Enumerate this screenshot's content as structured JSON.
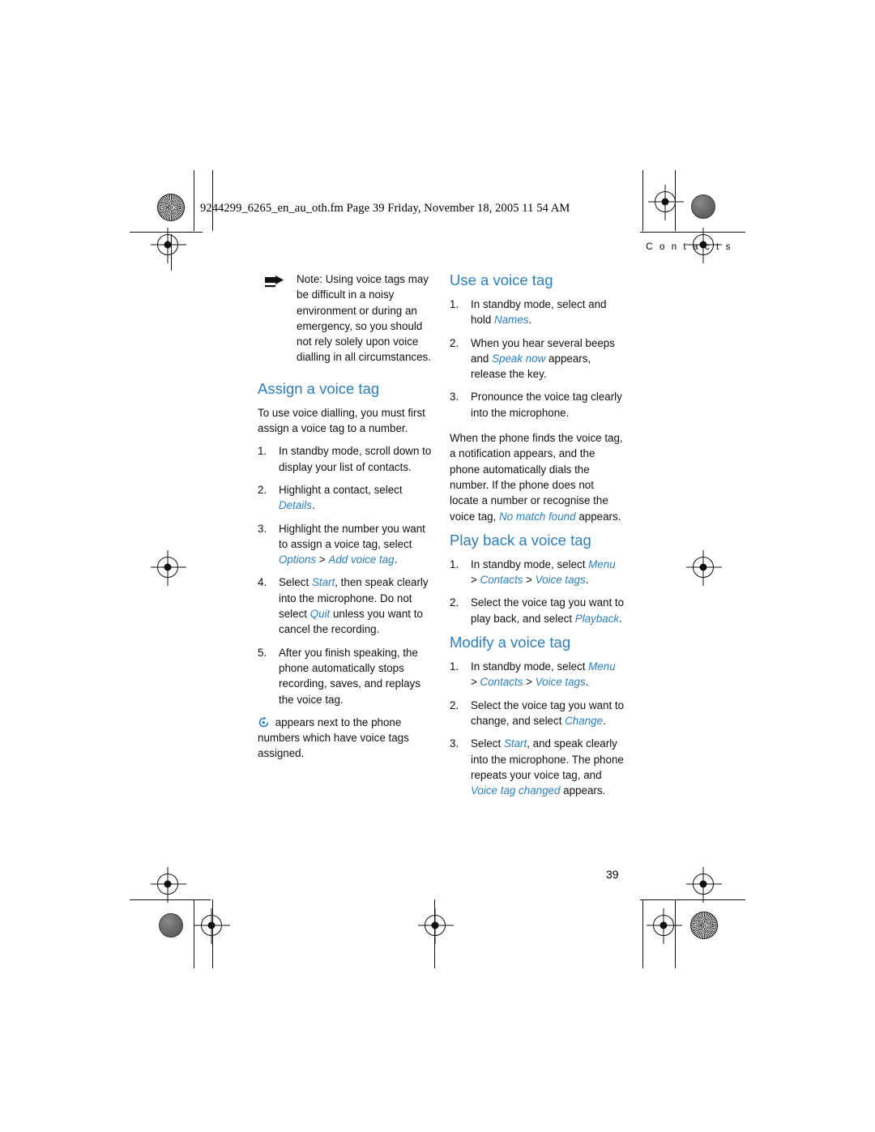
{
  "page": {
    "file_header": "9244299_6265_en_au_oth.fm  Page 39  Friday, November 18, 2005  11 54 AM",
    "running_head": "C o n t a c t s",
    "folio": "39",
    "accent_color": "#2a7fc2"
  },
  "left_column": {
    "note": {
      "label": "Note:",
      "text": " Using voice tags may be difficult in a noisy environment or during an emergency, so you should not rely solely upon voice dialling in all circumstances."
    },
    "assign": {
      "heading": "Assign a voice tag",
      "intro": "To use voice dialling, you must first assign a voice tag to a number.",
      "steps": [
        {
          "parts": [
            {
              "t": "In standby mode, scroll down to display your list of contacts.",
              "s": "plain"
            }
          ]
        },
        {
          "parts": [
            {
              "t": "Highlight a contact, select ",
              "s": "plain"
            },
            {
              "t": "Details",
              "s": "ui"
            },
            {
              "t": ".",
              "s": "plain"
            }
          ]
        },
        {
          "parts": [
            {
              "t": "Highlight the number you want to assign a voice tag, select ",
              "s": "plain"
            },
            {
              "t": "Options",
              "s": "ui"
            },
            {
              "t": " > ",
              "s": "plain"
            },
            {
              "t": "Add voice tag",
              "s": "ui"
            },
            {
              "t": ".",
              "s": "plain"
            }
          ]
        },
        {
          "parts": [
            {
              "t": "Select ",
              "s": "plain"
            },
            {
              "t": "Start",
              "s": "ui"
            },
            {
              "t": ", then speak clearly into the microphone. Do not select ",
              "s": "plain"
            },
            {
              "t": "Quit",
              "s": "ui"
            },
            {
              "t": " unless you want to cancel the recording.",
              "s": "plain"
            }
          ]
        },
        {
          "parts": [
            {
              "t": "After you finish speaking, the phone automatically stops recording, saves, and replays the voice tag.",
              "s": "plain"
            }
          ]
        }
      ],
      "closing": " appears next to the phone numbers which have voice tags assigned."
    }
  },
  "right_column": {
    "use": {
      "heading": "Use a voice tag",
      "steps": [
        {
          "parts": [
            {
              "t": "In standby mode, select and hold ",
              "s": "plain"
            },
            {
              "t": "Names",
              "s": "ui"
            },
            {
              "t": ".",
              "s": "plain"
            }
          ]
        },
        {
          "parts": [
            {
              "t": "When you hear several beeps and ",
              "s": "plain"
            },
            {
              "t": "Speak now",
              "s": "ui"
            },
            {
              "t": " appears, release the key.",
              "s": "plain"
            }
          ]
        },
        {
          "parts": [
            {
              "t": "Pronounce the voice tag clearly into the microphone.",
              "s": "plain"
            }
          ]
        }
      ],
      "continuation": [
        {
          "t": "When the phone finds the voice tag, a notification appears, and the phone automatically dials the number. If the phone does not locate a number or recognise the voice tag, ",
          "s": "plain"
        },
        {
          "t": "No match found",
          "s": "ui"
        },
        {
          "t": " appears.",
          "s": "plain"
        }
      ]
    },
    "playback": {
      "heading": "Play back a voice tag",
      "steps": [
        {
          "parts": [
            {
              "t": "In standby mode, select ",
              "s": "plain"
            },
            {
              "t": "Menu",
              "s": "ui"
            },
            {
              "t": " > ",
              "s": "plain"
            },
            {
              "t": "Contacts",
              "s": "ui"
            },
            {
              "t": " > ",
              "s": "plain"
            },
            {
              "t": "Voice tags",
              "s": "ui"
            },
            {
              "t": ".",
              "s": "plain"
            }
          ]
        },
        {
          "parts": [
            {
              "t": "Select the voice tag you want to play back, and select ",
              "s": "plain"
            },
            {
              "t": "Playback",
              "s": "ui"
            },
            {
              "t": ".",
              "s": "plain"
            }
          ]
        }
      ]
    },
    "modify": {
      "heading": "Modify a voice tag",
      "steps": [
        {
          "parts": [
            {
              "t": "In standby mode, select ",
              "s": "plain"
            },
            {
              "t": "Menu",
              "s": "ui"
            },
            {
              "t": " > ",
              "s": "plain"
            },
            {
              "t": "Contacts",
              "s": "ui"
            },
            {
              "t": " > ",
              "s": "plain"
            },
            {
              "t": "Voice tags",
              "s": "ui"
            },
            {
              "t": ".",
              "s": "plain"
            }
          ]
        },
        {
          "parts": [
            {
              "t": "Select the voice tag you want to change, and select ",
              "s": "plain"
            },
            {
              "t": "Change",
              "s": "ui"
            },
            {
              "t": ".",
              "s": "plain"
            }
          ]
        },
        {
          "parts": [
            {
              "t": "Select ",
              "s": "plain"
            },
            {
              "t": "Start",
              "s": "ui"
            },
            {
              "t": ", and speak clearly into the microphone. The phone repeats your voice tag, and ",
              "s": "plain"
            },
            {
              "t": "Voice tag changed",
              "s": "ui"
            },
            {
              "t": " appears.",
              "s": "plain"
            }
          ]
        }
      ]
    }
  },
  "icons": {
    "note": "note-hand-icon",
    "voice_tag": "voice-tag-icon"
  }
}
